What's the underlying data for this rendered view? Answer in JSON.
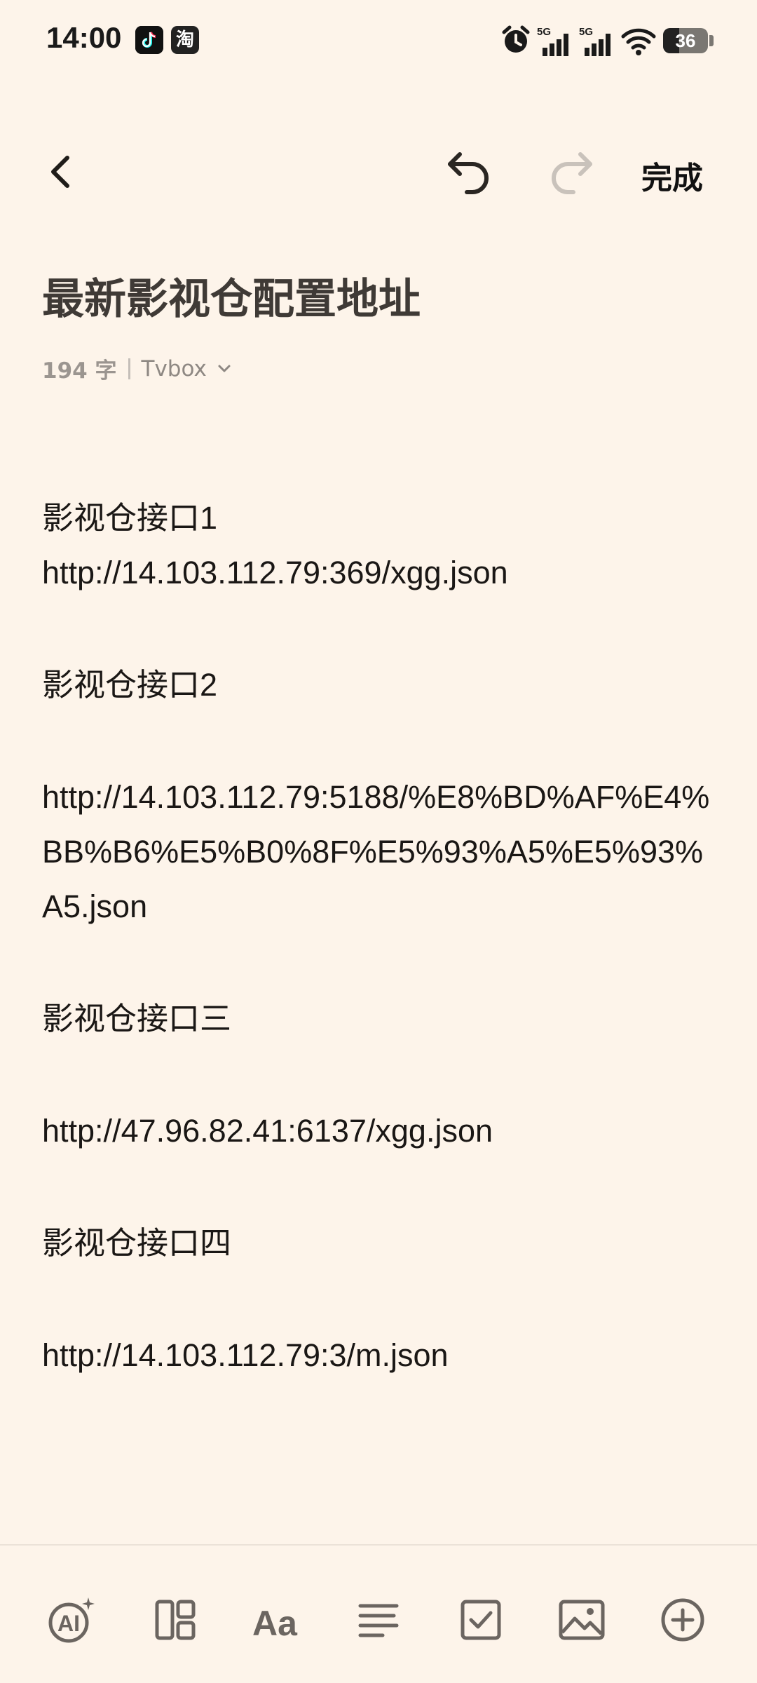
{
  "status_bar": {
    "time": "14:00",
    "app_badges": [
      "tiktok",
      "淘"
    ],
    "icons": [
      "alarm-icon",
      "signal-5g-icon",
      "signal-5g-icon",
      "wifi-icon",
      "battery-icon"
    ],
    "network_1": "5G",
    "network_2": "5G",
    "battery_level": "36"
  },
  "toolbar": {
    "back_icon": "chevron-left-icon",
    "undo_icon": "undo-icon",
    "redo_icon": "redo-icon",
    "done_label": "完成"
  },
  "note": {
    "title": "最新影视仓配置地址",
    "word_count": "194 字",
    "folder": "Tvbox",
    "lines": [
      "影视仓接口1",
      "http://14.103.112.79:369/xgg.json",
      "",
      "影视仓接口2",
      "",
      "http://14.103.112.79:5188/%E8%BD%AF%E4%BB%B6%E5%B0%8F%E5%93%A5%E5%93%A5.json",
      "",
      "影视仓接口三",
      "",
      "http://47.96.82.41:6137/xgg.json",
      "",
      "影视仓接口四",
      "",
      "http://14.103.112.79:3/m.json"
    ]
  },
  "bottom_toolbar": {
    "items": [
      "ai-assistant-icon",
      "layout-icon",
      "text-format-icon",
      "paragraph-align-icon",
      "checklist-icon",
      "image-icon",
      "add-icon"
    ]
  },
  "colors": {
    "background": "#fdf4ea",
    "title": "#3f3a36",
    "meta": "#9b9590",
    "text": "#1a1715",
    "disabled_icon": "#c9c2bb"
  }
}
